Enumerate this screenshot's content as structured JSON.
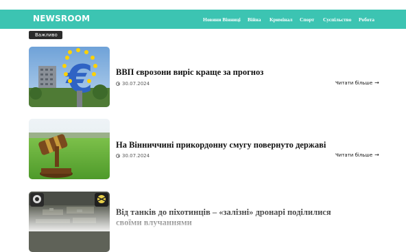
{
  "header": {
    "brand": "NEWSROOM",
    "nav": [
      "Новини Вінниці",
      "Війна",
      "Кримінал",
      "Спорт",
      "Суспільство",
      "Робота"
    ]
  },
  "badge": "Важливо",
  "articles": [
    {
      "title": "ВВП єврозони виріс краще за прогноз",
      "date": "30.07.2024",
      "read_more": "Читати більше",
      "image": "euro-sign-sculpture"
    },
    {
      "title": "На Вінниччині прикордонну смугу повернуто державі",
      "date": "30.07.2024",
      "read_more": "Читати більше",
      "image": "judge-gavel-field"
    },
    {
      "title": "Від танків до піхотинців – «залізні» дронарі поділилися своїми влучаннями",
      "date": "",
      "read_more": "",
      "image": "drone-footage"
    }
  ],
  "colors": {
    "navbar": "#3cc4b2",
    "badge": "#2b2b2b"
  }
}
